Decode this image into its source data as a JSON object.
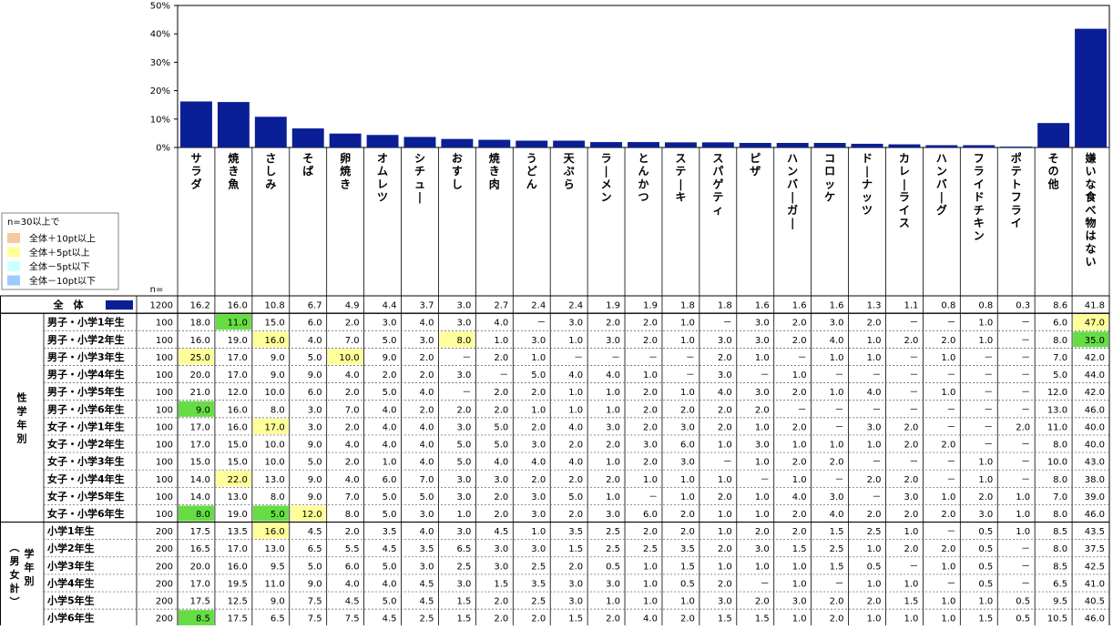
{
  "chart_data": {
    "type": "bar",
    "yaxis": {
      "ylim": [
        0,
        50
      ],
      "ticks": [
        "0%",
        "10%",
        "20%",
        "30%",
        "40%",
        "50%"
      ]
    },
    "categories": [
      "サラダ",
      "焼き魚",
      "さしみ",
      "そば",
      "卵焼き",
      "オムレツ",
      "シチュー",
      "おすし",
      "焼き肉",
      "うどん",
      "天ぷら",
      "ラーメン",
      "とんかつ",
      "ステーキ",
      "スパゲティ",
      "ピザ",
      "ハンバーガー",
      "コロッケ",
      "ドーナッツ",
      "カレーライス",
      "ハンバーグ",
      "フライドチキン",
      "ポテトフライ",
      "その他",
      "嫌いな食べ物はない"
    ],
    "values": [
      16.2,
      16.0,
      10.8,
      6.7,
      4.9,
      4.4,
      3.7,
      3.0,
      2.7,
      2.4,
      2.4,
      1.9,
      1.9,
      1.8,
      1.8,
      1.6,
      1.6,
      1.6,
      1.3,
      1.1,
      0.8,
      0.8,
      0.3,
      8.6,
      41.8
    ],
    "bar_color": "#0a1e96",
    "n_label": "n=",
    "legend": {
      "title": "n=30以上で",
      "items": [
        {
          "label": "全体＋10pt以上",
          "color": "#f5c8a0"
        },
        {
          "label": "全体＋5pt以上",
          "color": "#ffff99"
        },
        {
          "label": "全体－5pt以下",
          "color": "#ccffff"
        },
        {
          "label": "全体－10pt以下",
          "color": "#99ccff"
        }
      ]
    },
    "total_row": {
      "label": "全　体",
      "n": "1200",
      "values": [
        "16.2",
        "16.0",
        "10.8",
        "6.7",
        "4.9",
        "4.4",
        "3.7",
        "3.0",
        "2.7",
        "2.4",
        "2.4",
        "1.9",
        "1.9",
        "1.8",
        "1.8",
        "1.6",
        "1.6",
        "1.6",
        "1.3",
        "1.1",
        "0.8",
        "0.8",
        "0.3",
        "8.6",
        "41.8"
      ]
    },
    "groups": [
      {
        "label": [
          "性",
          "学",
          "年",
          "別"
        ],
        "rows": [
          {
            "label": "男子・小学1年生",
            "n": "100",
            "values": [
              "18.0",
              "11.0",
              "15.0",
              "6.0",
              "2.0",
              "3.0",
              "4.0",
              "3.0",
              "4.0",
              "－",
              "3.0",
              "2.0",
              "2.0",
              "1.0",
              "－",
              "3.0",
              "2.0",
              "3.0",
              "2.0",
              "－",
              "－",
              "1.0",
              "－",
              "6.0",
              "47.0"
            ]
          },
          {
            "label": "男子・小学2年生",
            "n": "100",
            "values": [
              "16.0",
              "19.0",
              "16.0",
              "4.0",
              "7.0",
              "5.0",
              "3.0",
              "8.0",
              "1.0",
              "3.0",
              "1.0",
              "3.0",
              "2.0",
              "1.0",
              "3.0",
              "3.0",
              "2.0",
              "4.0",
              "1.0",
              "2.0",
              "2.0",
              "1.0",
              "－",
              "8.0",
              "35.0"
            ]
          },
          {
            "label": "男子・小学3年生",
            "n": "100",
            "values": [
              "25.0",
              "17.0",
              "9.0",
              "5.0",
              "10.0",
              "9.0",
              "2.0",
              "－",
              "2.0",
              "1.0",
              "－",
              "－",
              "－",
              "－",
              "2.0",
              "1.0",
              "－",
              "1.0",
              "1.0",
              "－",
              "1.0",
              "－",
              "－",
              "7.0",
              "42.0"
            ]
          },
          {
            "label": "男子・小学4年生",
            "n": "100",
            "values": [
              "20.0",
              "17.0",
              "9.0",
              "9.0",
              "4.0",
              "2.0",
              "2.0",
              "3.0",
              "－",
              "5.0",
              "4.0",
              "4.0",
              "1.0",
              "－",
              "3.0",
              "－",
              "1.0",
              "－",
              "－",
              "－",
              "－",
              "－",
              "－",
              "5.0",
              "44.0"
            ]
          },
          {
            "label": "男子・小学5年生",
            "n": "100",
            "values": [
              "21.0",
              "12.0",
              "10.0",
              "6.0",
              "2.0",
              "5.0",
              "4.0",
              "－",
              "2.0",
              "2.0",
              "1.0",
              "1.0",
              "2.0",
              "1.0",
              "4.0",
              "3.0",
              "2.0",
              "1.0",
              "4.0",
              "－",
              "1.0",
              "－",
              "－",
              "12.0",
              "42.0"
            ]
          },
          {
            "label": "男子・小学6年生",
            "n": "100",
            "values": [
              "9.0",
              "16.0",
              "8.0",
              "3.0",
              "7.0",
              "4.0",
              "2.0",
              "2.0",
              "2.0",
              "1.0",
              "1.0",
              "1.0",
              "2.0",
              "2.0",
              "2.0",
              "2.0",
              "－",
              "－",
              "－",
              "－",
              "－",
              "－",
              "－",
              "13.0",
              "46.0"
            ]
          },
          {
            "label": "女子・小学1年生",
            "n": "100",
            "values": [
              "17.0",
              "16.0",
              "17.0",
              "3.0",
              "2.0",
              "4.0",
              "4.0",
              "3.0",
              "5.0",
              "2.0",
              "4.0",
              "3.0",
              "2.0",
              "3.0",
              "2.0",
              "1.0",
              "2.0",
              "－",
              "3.0",
              "2.0",
              "－",
              "－",
              "2.0",
              "11.0",
              "40.0"
            ]
          },
          {
            "label": "女子・小学2年生",
            "n": "100",
            "values": [
              "17.0",
              "15.0",
              "10.0",
              "9.0",
              "4.0",
              "4.0",
              "4.0",
              "5.0",
              "5.0",
              "3.0",
              "2.0",
              "2.0",
              "3.0",
              "6.0",
              "1.0",
              "3.0",
              "1.0",
              "1.0",
              "1.0",
              "2.0",
              "2.0",
              "－",
              "－",
              "8.0",
              "40.0"
            ]
          },
          {
            "label": "女子・小学3年生",
            "n": "100",
            "values": [
              "15.0",
              "15.0",
              "10.0",
              "5.0",
              "2.0",
              "1.0",
              "4.0",
              "5.0",
              "4.0",
              "4.0",
              "4.0",
              "1.0",
              "2.0",
              "3.0",
              "－",
              "1.0",
              "2.0",
              "2.0",
              "－",
              "－",
              "－",
              "1.0",
              "－",
              "10.0",
              "43.0"
            ]
          },
          {
            "label": "女子・小学4年生",
            "n": "100",
            "values": [
              "14.0",
              "22.0",
              "13.0",
              "9.0",
              "4.0",
              "6.0",
              "7.0",
              "3.0",
              "3.0",
              "2.0",
              "2.0",
              "2.0",
              "1.0",
              "1.0",
              "1.0",
              "－",
              "1.0",
              "－",
              "2.0",
              "2.0",
              "－",
              "1.0",
              "－",
              "8.0",
              "38.0"
            ]
          },
          {
            "label": "女子・小学5年生",
            "n": "100",
            "values": [
              "14.0",
              "13.0",
              "8.0",
              "9.0",
              "7.0",
              "5.0",
              "5.0",
              "3.0",
              "2.0",
              "3.0",
              "5.0",
              "1.0",
              "－",
              "1.0",
              "2.0",
              "1.0",
              "4.0",
              "3.0",
              "－",
              "3.0",
              "1.0",
              "2.0",
              "1.0",
              "7.0",
              "39.0"
            ]
          },
          {
            "label": "女子・小学6年生",
            "n": "100",
            "values": [
              "8.0",
              "19.0",
              "5.0",
              "12.0",
              "8.0",
              "5.0",
              "3.0",
              "1.0",
              "2.0",
              "3.0",
              "2.0",
              "3.0",
              "6.0",
              "2.0",
              "1.0",
              "1.0",
              "2.0",
              "4.0",
              "2.0",
              "2.0",
              "2.0",
              "3.0",
              "1.0",
              "8.0",
              "46.0"
            ]
          }
        ]
      },
      {
        "label": [
          "（",
          "男",
          "女",
          "計",
          "）",
          "学",
          "年",
          "別"
        ],
        "rows": [
          {
            "label": "小学1年生",
            "n": "200",
            "values": [
              "17.5",
              "13.5",
              "16.0",
              "4.5",
              "2.0",
              "3.5",
              "4.0",
              "3.0",
              "4.5",
              "1.0",
              "3.5",
              "2.5",
              "2.0",
              "2.0",
              "1.0",
              "2.0",
              "2.0",
              "1.5",
              "2.5",
              "1.0",
              "－",
              "0.5",
              "1.0",
              "8.5",
              "43.5"
            ]
          },
          {
            "label": "小学2年生",
            "n": "200",
            "values": [
              "16.5",
              "17.0",
              "13.0",
              "6.5",
              "5.5",
              "4.5",
              "3.5",
              "6.5",
              "3.0",
              "3.0",
              "1.5",
              "2.5",
              "2.5",
              "3.5",
              "2.0",
              "3.0",
              "1.5",
              "2.5",
              "1.0",
              "2.0",
              "2.0",
              "0.5",
              "－",
              "8.0",
              "37.5"
            ]
          },
          {
            "label": "小学3年生",
            "n": "200",
            "values": [
              "20.0",
              "16.0",
              "9.5",
              "5.0",
              "6.0",
              "5.0",
              "3.0",
              "2.5",
              "3.0",
              "2.5",
              "2.0",
              "0.5",
              "1.0",
              "1.5",
              "1.0",
              "1.0",
              "1.0",
              "1.5",
              "0.5",
              "－",
              "1.0",
              "0.5",
              "－",
              "8.5",
              "42.5"
            ]
          },
          {
            "label": "小学4年生",
            "n": "200",
            "values": [
              "17.0",
              "19.5",
              "11.0",
              "9.0",
              "4.0",
              "4.0",
              "4.5",
              "3.0",
              "1.5",
              "3.5",
              "3.0",
              "3.0",
              "1.0",
              "0.5",
              "2.0",
              "－",
              "1.0",
              "－",
              "1.0",
              "1.0",
              "－",
              "0.5",
              "－",
              "6.5",
              "41.0"
            ]
          },
          {
            "label": "小学5年生",
            "n": "200",
            "values": [
              "17.5",
              "12.5",
              "9.0",
              "7.5",
              "4.5",
              "5.0",
              "4.5",
              "1.5",
              "2.0",
              "2.5",
              "3.0",
              "1.0",
              "1.0",
              "1.0",
              "3.0",
              "2.0",
              "3.0",
              "2.0",
              "2.0",
              "1.5",
              "1.0",
              "1.0",
              "0.5",
              "9.5",
              "40.5"
            ]
          },
          {
            "label": "小学6年生",
            "n": "200",
            "values": [
              "8.5",
              "17.5",
              "6.5",
              "7.5",
              "7.5",
              "4.5",
              "2.5",
              "1.5",
              "2.0",
              "2.0",
              "1.5",
              "2.0",
              "4.0",
              "2.0",
              "1.5",
              "1.5",
              "1.0",
              "2.0",
              "1.0",
              "1.0",
              "1.0",
              "1.5",
              "0.5",
              "10.5",
              "46.0"
            ]
          }
        ]
      }
    ],
    "highlights": [
      {
        "row": 1,
        "col": 1,
        "color": "#66dd44"
      },
      {
        "row": 1,
        "col": 24,
        "color": "#ffff99"
      },
      {
        "row": 2,
        "col": 2,
        "color": "#ffff99"
      },
      {
        "row": 2,
        "col": 7,
        "color": "#ffff99"
      },
      {
        "row": 2,
        "col": 24,
        "color": "#66dd44"
      },
      {
        "row": 3,
        "col": 0,
        "color": "#ffff99"
      },
      {
        "row": 3,
        "col": 4,
        "color": "#ffff99"
      },
      {
        "row": 6,
        "col": 0,
        "color": "#66dd44"
      },
      {
        "row": 7,
        "col": 2,
        "color": "#ffff99"
      },
      {
        "row": 10,
        "col": 1,
        "color": "#ffff99"
      },
      {
        "row": 12,
        "col": 0,
        "color": "#66dd44"
      },
      {
        "row": 12,
        "col": 2,
        "color": "#66dd44"
      },
      {
        "row": 12,
        "col": 3,
        "color": "#ffff99"
      },
      {
        "row": 13,
        "col": 2,
        "color": "#ffff99"
      },
      {
        "row": 18,
        "col": 0,
        "color": "#66dd44"
      }
    ]
  }
}
